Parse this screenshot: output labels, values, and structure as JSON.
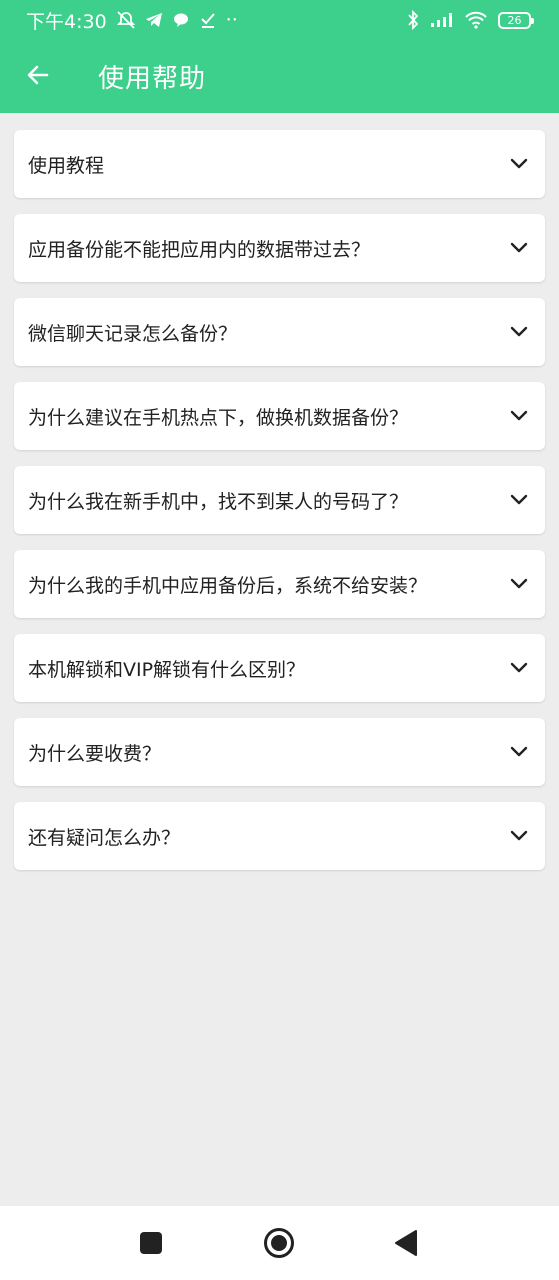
{
  "status_bar": {
    "time": "下午4:30",
    "battery": "26",
    "icons": [
      "alarm-off-icon",
      "telegram-icon",
      "chat-bubble-icon",
      "check-download-icon",
      "more-dots-icon",
      "bluetooth-icon",
      "signal-icon",
      "wifi-icon",
      "battery-icon"
    ],
    "more_dots": "··"
  },
  "app_bar": {
    "title": "使用帮助",
    "back_icon": "arrow-left-icon",
    "color": "#3dcf8c"
  },
  "faq": [
    {
      "question": "使用教程"
    },
    {
      "question": "应用备份能不能把应用内的数据带过去？"
    },
    {
      "question": "微信聊天记录怎么备份？"
    },
    {
      "question": "为什么建议在手机热点下，做换机数据备份？"
    },
    {
      "question": "为什么我在新手机中，找不到某人的号码了？"
    },
    {
      "question": "为什么我的手机中应用备份后，系统不给安装？"
    },
    {
      "question": "本机解锁和VIP解锁有什么区别？"
    },
    {
      "question": "为什么要收费？"
    },
    {
      "question": "还有疑问怎么办？"
    }
  ],
  "nav_bar": {
    "icons": [
      "recents-square-icon",
      "home-circle-icon",
      "back-triangle-icon"
    ]
  }
}
